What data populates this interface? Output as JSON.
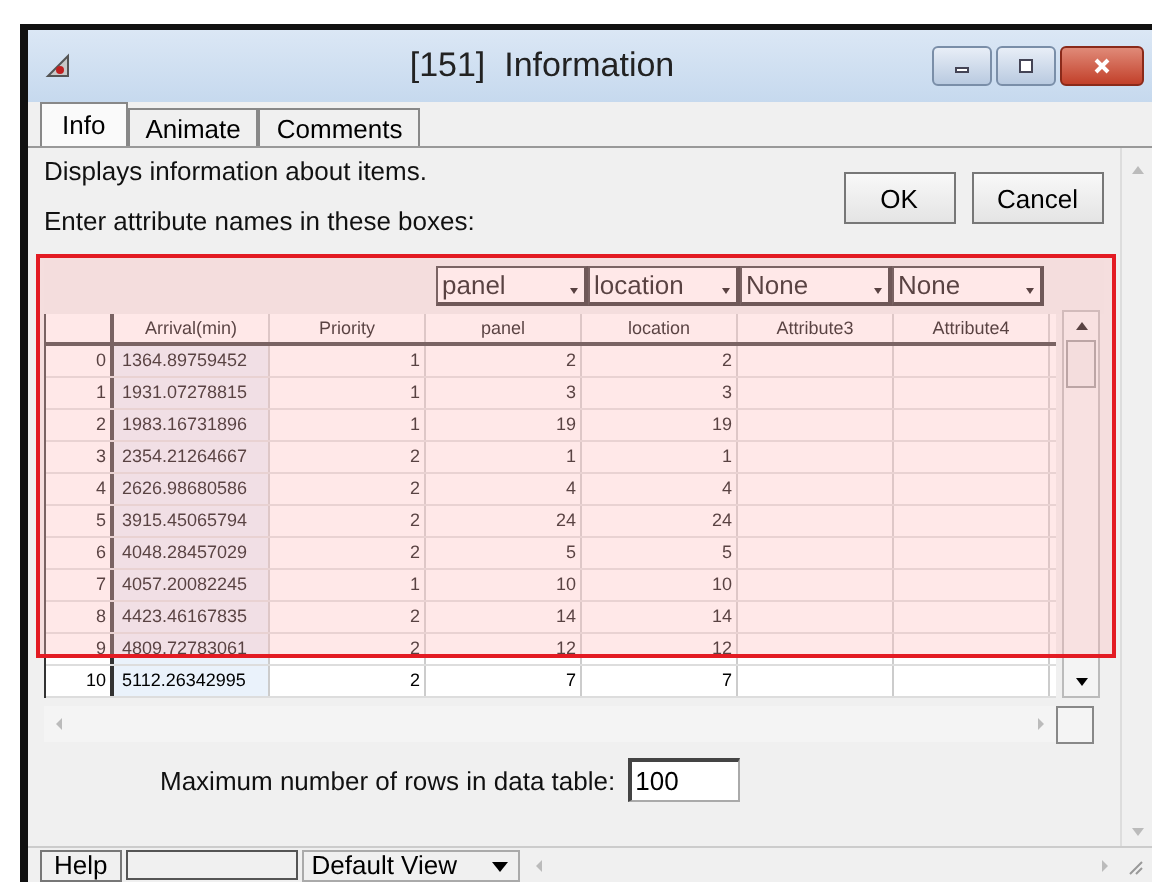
{
  "window": {
    "title": "[151]  Information"
  },
  "tabs": [
    {
      "label": "Info",
      "selected": true
    },
    {
      "label": "Animate",
      "selected": false
    },
    {
      "label": "Comments",
      "selected": false
    }
  ],
  "description": "Displays information about items.",
  "prompt": "Enter attribute names in these boxes:",
  "buttons": [
    "OK",
    "Cancel"
  ],
  "attribute_boxes": [
    "panel",
    "location",
    "None",
    "None"
  ],
  "table": {
    "columns": [
      "",
      "Arrival(min)",
      "Priority",
      "panel",
      "location",
      "Attribute3",
      "Attribute4"
    ],
    "rows": [
      [
        "0",
        "1364.89759452",
        "1",
        "2",
        "2"
      ],
      [
        "1",
        "1931.07278815",
        "1",
        "3",
        "3"
      ],
      [
        "2",
        "1983.16731896",
        "1",
        "19",
        "19"
      ],
      [
        "3",
        "2354.21264667",
        "2",
        "1",
        "1"
      ],
      [
        "4",
        "2626.98680586",
        "2",
        "4",
        "4"
      ],
      [
        "5",
        "3915.45065794",
        "2",
        "24",
        "24"
      ],
      [
        "6",
        "4048.28457029",
        "2",
        "5",
        "5"
      ],
      [
        "7",
        "4057.20082245",
        "1",
        "10",
        "10"
      ],
      [
        "8",
        "4423.46167835",
        "2",
        "14",
        "14"
      ],
      [
        "9",
        "4809.72783061",
        "2",
        "12",
        "12"
      ],
      [
        "10",
        "5112.26342995",
        "2",
        "7",
        "7"
      ]
    ]
  },
  "max_rows": {
    "label": "Maximum number of rows in data table:",
    "value": "100"
  },
  "bottom_bar": {
    "help": "Help",
    "view": "Default View"
  }
}
